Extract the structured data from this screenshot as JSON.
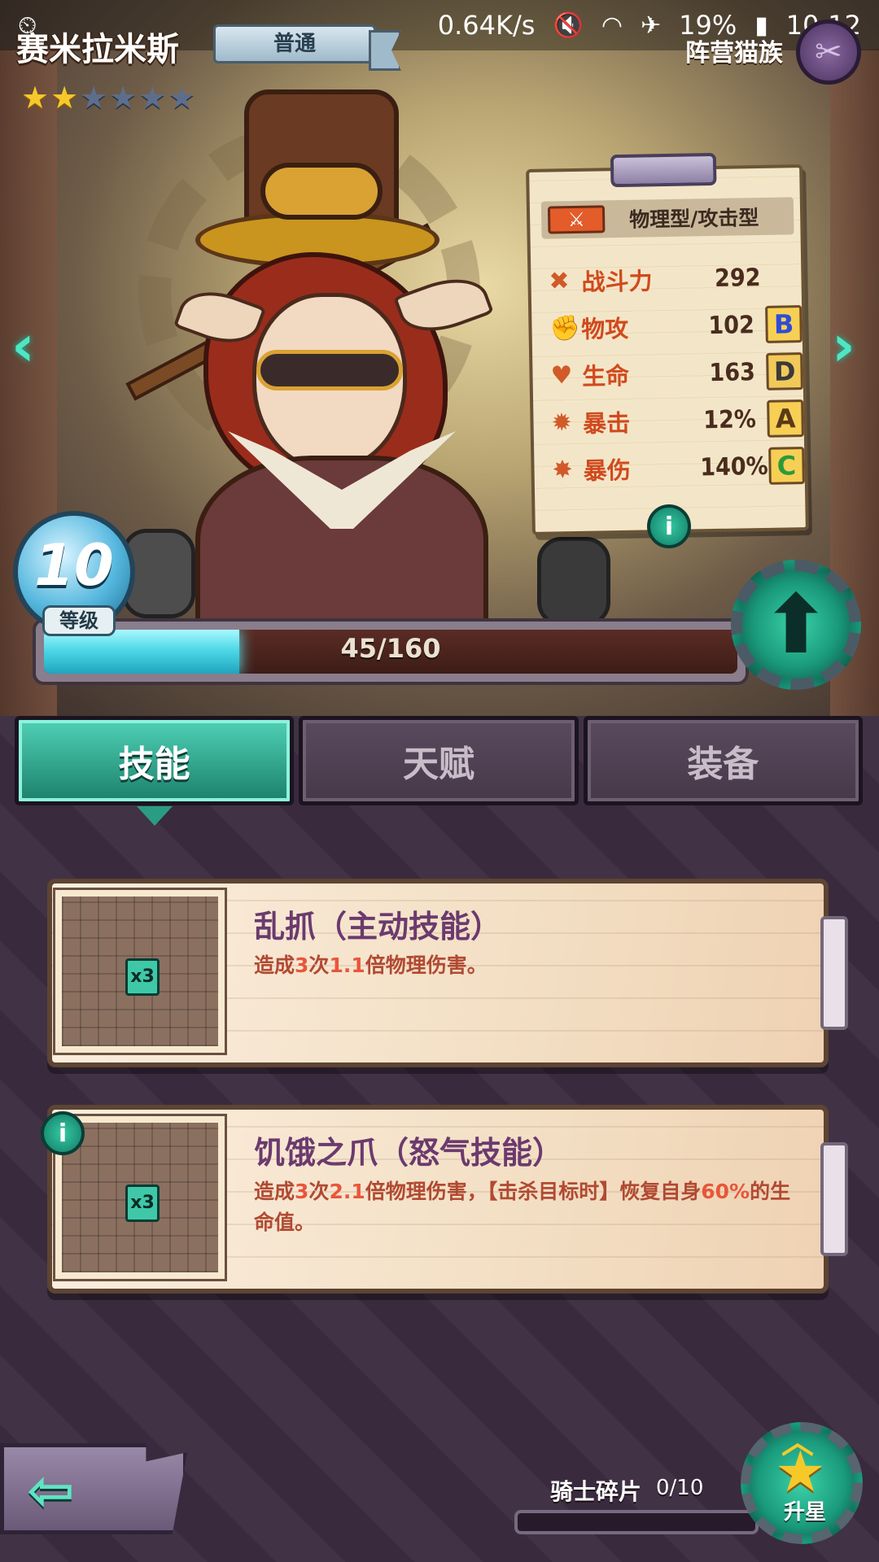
{
  "status_bar": {
    "net_speed": "0.64K/s",
    "battery": "19%",
    "time": "10:12",
    "icons": [
      "alarm-icon",
      "mute-icon",
      "wifi-icon",
      "airplane-icon",
      "battery-icon"
    ]
  },
  "hero": {
    "name": "赛米拉米斯",
    "rarity": "普通",
    "stars_total": 6,
    "stars_on": 2,
    "faction": "阵营猫族",
    "level": "10",
    "level_label": "等级",
    "exp": {
      "current": 45,
      "max": 160,
      "text": "45/160"
    }
  },
  "stats": {
    "type": "物理型/攻击型",
    "rows": [
      {
        "name": "战斗力",
        "value": "292",
        "grade": "",
        "icon": "power-icon"
      },
      {
        "name": "物攻",
        "value": "102",
        "grade": "B",
        "icon": "fist-icon"
      },
      {
        "name": "生命",
        "value": "163",
        "grade": "D",
        "icon": "heart-icon"
      },
      {
        "name": "暴击",
        "value": "12%",
        "grade": "A",
        "icon": "crit-icon"
      },
      {
        "name": "暴伤",
        "value": "140%",
        "grade": "C",
        "icon": "crit-damage-icon"
      }
    ]
  },
  "tabs": [
    {
      "label": "技能",
      "active": true
    },
    {
      "label": "天赋",
      "active": false
    },
    {
      "label": "装备",
      "active": false
    }
  ],
  "skills": [
    {
      "title": "乱抓（主动技能）",
      "mult": "x3",
      "desc_parts": [
        "造成",
        "3",
        "次",
        "1.1",
        "倍物理伤害。"
      ]
    },
    {
      "title": "饥饿之爪（怒气技能）",
      "mult": "x3",
      "desc_parts": [
        "造成",
        "3",
        "次",
        "2.1",
        "倍物理伤害，【击杀目标时】恢复自身",
        "60%",
        "的生命值。"
      ]
    }
  ],
  "bottom": {
    "shard_label": "骑士碎片",
    "shard_count": "0/10",
    "shard_progress": 0,
    "star_up_label": "升星"
  },
  "colors": {
    "accent": "#3ad2a8",
    "star_on": "#f6c92b",
    "skill_title": "#6b3a6e",
    "skill_desc": "#b14a33"
  }
}
